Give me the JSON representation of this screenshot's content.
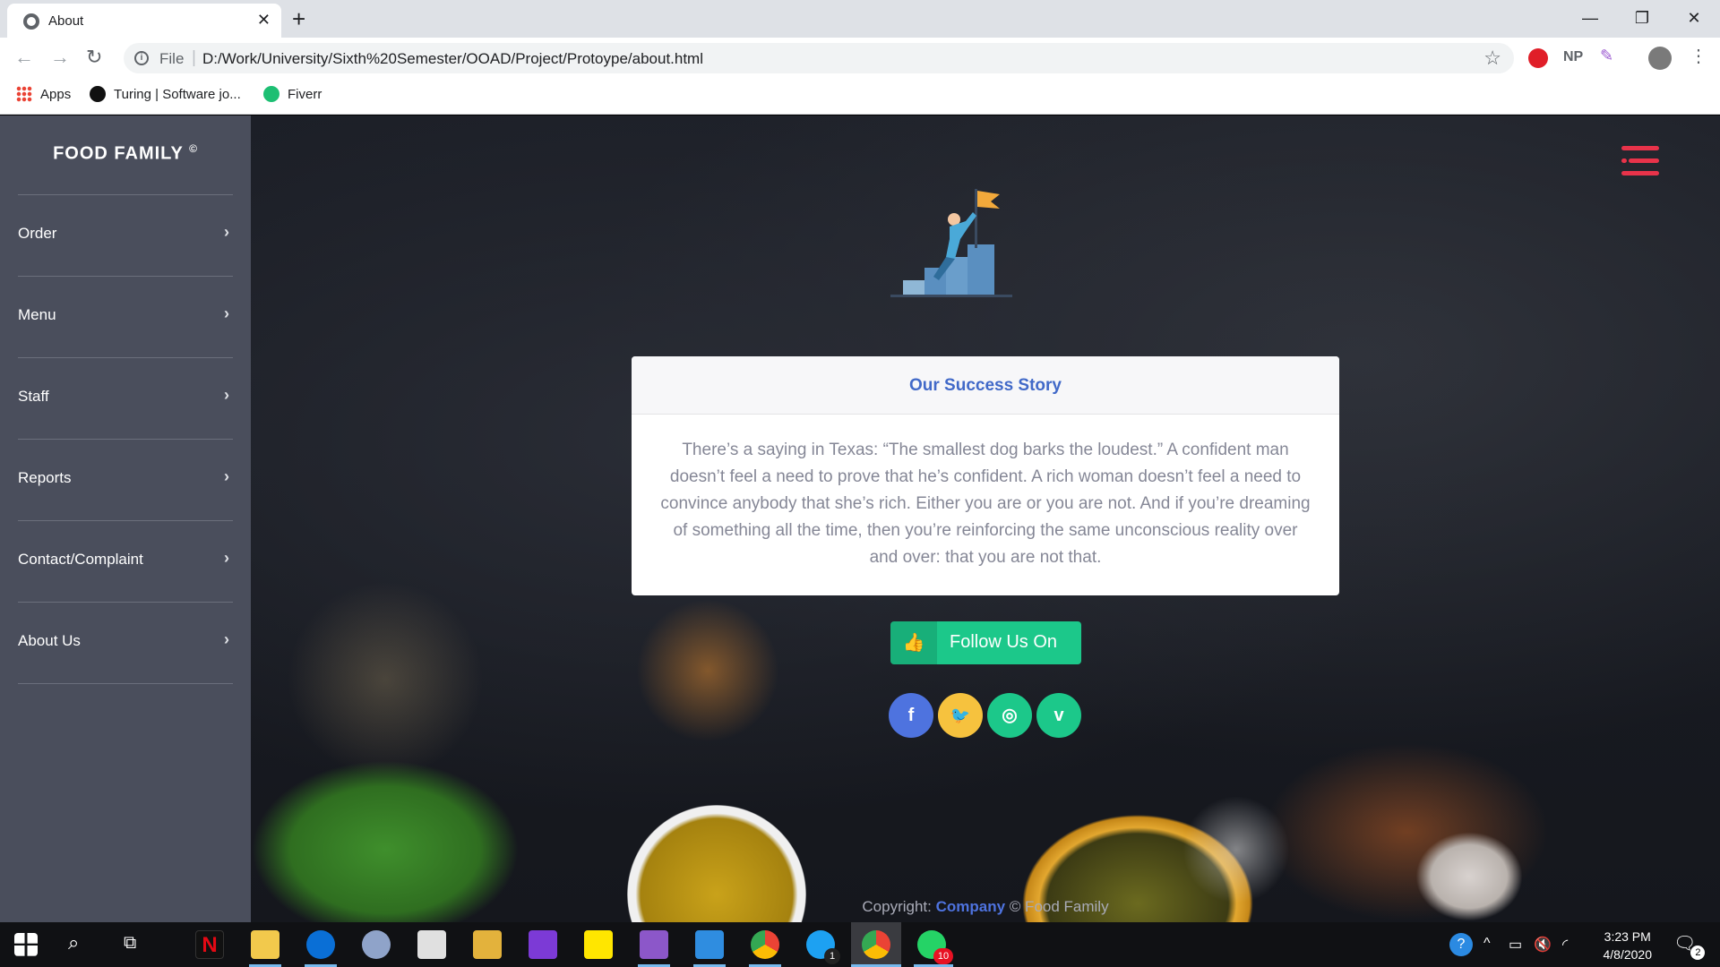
{
  "browser": {
    "tab_title": "About",
    "tab_close": "✕",
    "new_tab": "+",
    "window": {
      "minimize": "—",
      "restore": "❐",
      "close": "✕"
    },
    "url_prefix": "File",
    "url": "D:/Work/University/Sixth%20Semester/OOAD/Project/Protoype/about.html",
    "extension_np": "NP",
    "bookmarks": [
      "Apps",
      "Turing | Software jo...",
      "Fiverr"
    ]
  },
  "sidebar": {
    "brand": "FOOD FAMILY",
    "brand_mark": "©",
    "items": [
      {
        "label": "Order"
      },
      {
        "label": "Menu"
      },
      {
        "label": "Staff"
      },
      {
        "label": "Reports"
      },
      {
        "label": "Contact/Complaint"
      },
      {
        "label": "About Us"
      }
    ],
    "chevron": "›"
  },
  "story": {
    "title": "Our Success Story",
    "body": "There’s a saying in Texas: “The smallest dog barks the loudest.” A confident man doesn’t feel a need to prove that he’s confident. A rich woman doesn’t feel a need to convince anybody that she’s rich. Either you are or you are not. And if you’re dreaming of something all the time, then you’re reinforcing the same unconscious reality over and over: that you are not that."
  },
  "follow": {
    "label": "Follow Us On",
    "icon": "thumbs-up-icon"
  },
  "social": [
    {
      "name": "facebook",
      "glyph": "f",
      "color": "#4e73df"
    },
    {
      "name": "twitter",
      "glyph": "🐦",
      "color": "#f6c23e"
    },
    {
      "name": "instagram",
      "glyph": "◎",
      "color": "#1cc88a"
    },
    {
      "name": "vimeo",
      "glyph": "v",
      "color": "#1cc88a"
    }
  ],
  "footer": {
    "prefix": "Copyright:",
    "company": "Company",
    "suffix": "© Food Family"
  },
  "taskbar": {
    "time": "3:23 PM",
    "date": "4/8/2020",
    "skype_badge": "1",
    "whatsapp_badge": "10",
    "notification_badge": "2"
  },
  "colors": {
    "sidebar": "#4a4e5c",
    "accent_blue": "#4169c8",
    "success_green": "#1cc88a",
    "hamburger_red": "#e8334a"
  }
}
